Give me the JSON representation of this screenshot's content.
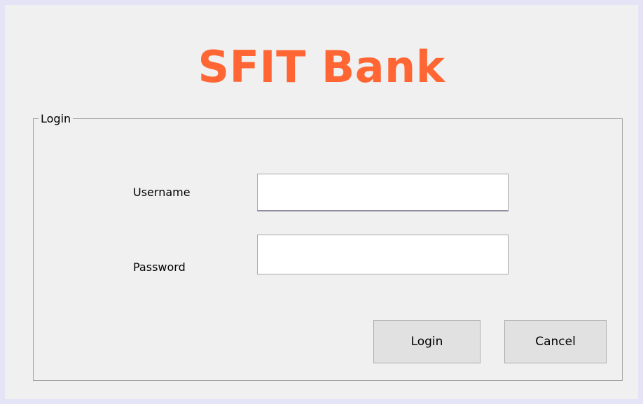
{
  "app": {
    "title": "SFIT Bank",
    "title_color": "#ff6633"
  },
  "login_group": {
    "legend": "Login",
    "username_label": "Username",
    "username_value": "",
    "password_label": "Password",
    "password_value": "",
    "login_button": "Login",
    "cancel_button": "Cancel"
  }
}
